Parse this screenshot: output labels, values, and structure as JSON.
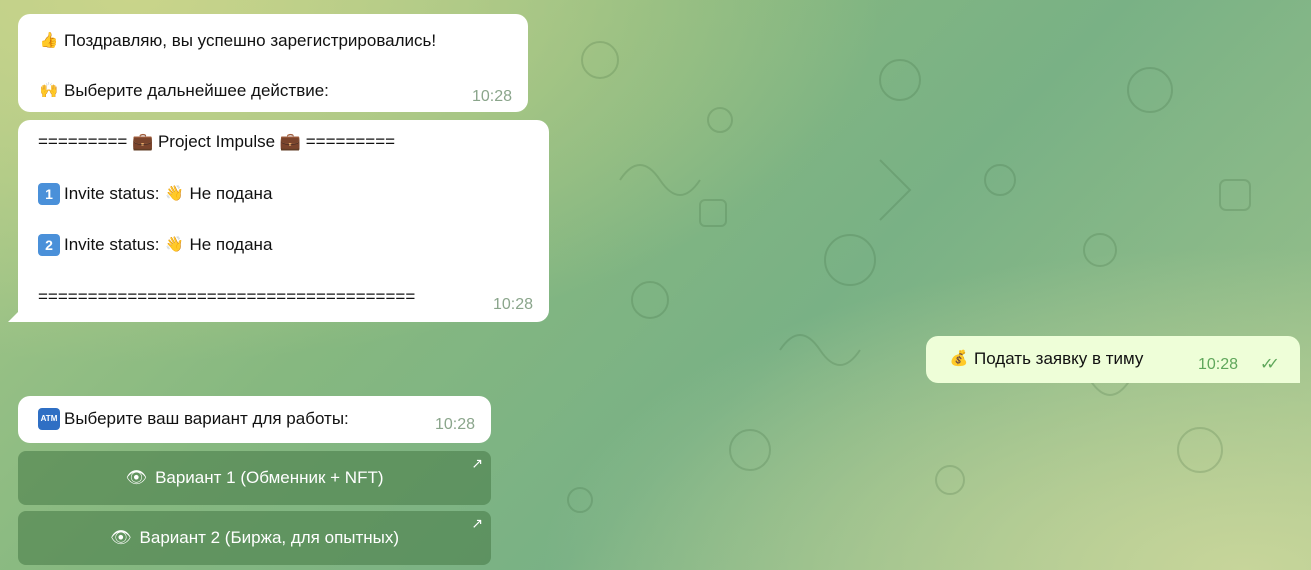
{
  "messages": {
    "m1": {
      "line1": "Поздравляю, вы успешно зарегистрировались!",
      "line2": "Выберите дальнейшее действие:",
      "time": "10:28"
    },
    "m2": {
      "header": "========= 💼 Project Impulse 💼 =========",
      "invite1_label": "Invite status:",
      "invite1_value": "Не подана",
      "invite2_label": "Invite status:",
      "invite2_value": "Не подана",
      "footer": "======================================",
      "time": "10:28"
    },
    "m3_out": {
      "text": "Подать заявку в тиму",
      "time": "10:28"
    },
    "m4": {
      "text": "Выберите ваш вариант для работы:",
      "time": "10:28"
    }
  },
  "buttons": {
    "b1": "Вариант 1 (Обменник + NFT)",
    "b2": "Вариант 2 (Биржа, для опытных)"
  },
  "icons": {
    "thumbs_up": "thumbs-up-icon",
    "raised_hands": "raised-hands-icon",
    "briefcase": "briefcase-icon",
    "keycap_one": "keycap-1-icon",
    "keycap_two": "keycap-2-icon",
    "waving_hand": "waving-hand-icon",
    "money_bag": "money-bag-icon",
    "atm": "atm-icon",
    "eye": "eye-icon",
    "read_checks": "double-check-icon",
    "open_link": "arrow-up-right-icon"
  },
  "colors": {
    "bubble_in": "#ffffff",
    "bubble_out": "#eefed8",
    "time_in": "#8aa58b",
    "time_out": "#5fa75b",
    "button_bg": "#5f8f5c"
  }
}
